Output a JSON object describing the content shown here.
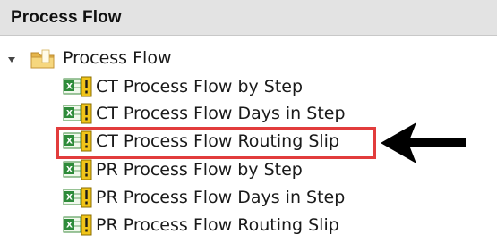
{
  "panel": {
    "title": "Process Flow"
  },
  "tree": {
    "folder": {
      "label": "Process Flow",
      "icon": "folder-icon",
      "expanded": true
    },
    "items": [
      {
        "label": "CT Process Flow by Step",
        "icon": "excel-report-icon"
      },
      {
        "label": "CT Process Flow Days in Step",
        "icon": "excel-report-icon"
      },
      {
        "label": "CT Process Flow Routing Slip",
        "icon": "excel-report-icon",
        "highlighted": true
      },
      {
        "label": "PR Process Flow by Step",
        "icon": "excel-report-icon"
      },
      {
        "label": "PR Process Flow Days in Step",
        "icon": "excel-report-icon"
      },
      {
        "label": "PR Process Flow Routing Slip",
        "icon": "excel-report-icon"
      }
    ]
  },
  "annotation": {
    "highlight_color": "#e23c3c",
    "arrow_color": "#000000",
    "arrow_icon": "arrow-left-icon"
  }
}
